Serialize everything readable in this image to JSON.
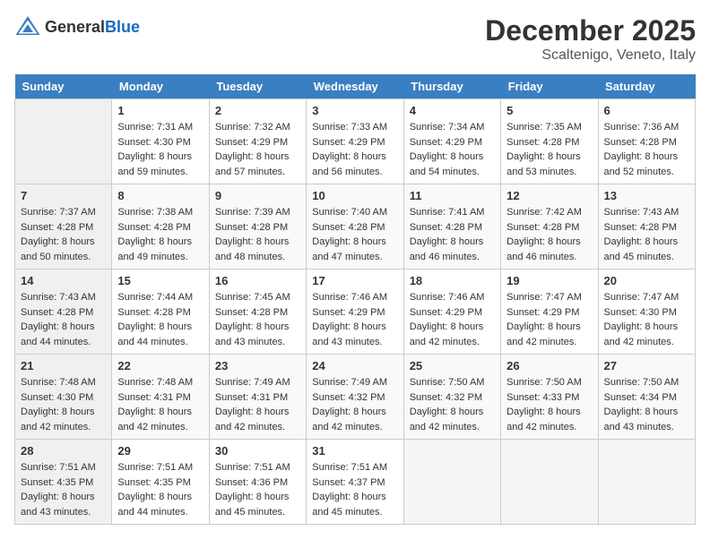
{
  "header": {
    "logo_general": "General",
    "logo_blue": "Blue",
    "month": "December 2025",
    "location": "Scaltenigo, Veneto, Italy"
  },
  "days_of_week": [
    "Sunday",
    "Monday",
    "Tuesday",
    "Wednesday",
    "Thursday",
    "Friday",
    "Saturday"
  ],
  "weeks": [
    [
      {
        "day": "",
        "sunrise": "",
        "sunset": "",
        "daylight": "",
        "empty": true
      },
      {
        "day": "1",
        "sunrise": "Sunrise: 7:31 AM",
        "sunset": "Sunset: 4:30 PM",
        "daylight": "Daylight: 8 hours and 59 minutes."
      },
      {
        "day": "2",
        "sunrise": "Sunrise: 7:32 AM",
        "sunset": "Sunset: 4:29 PM",
        "daylight": "Daylight: 8 hours and 57 minutes."
      },
      {
        "day": "3",
        "sunrise": "Sunrise: 7:33 AM",
        "sunset": "Sunset: 4:29 PM",
        "daylight": "Daylight: 8 hours and 56 minutes."
      },
      {
        "day": "4",
        "sunrise": "Sunrise: 7:34 AM",
        "sunset": "Sunset: 4:29 PM",
        "daylight": "Daylight: 8 hours and 54 minutes."
      },
      {
        "day": "5",
        "sunrise": "Sunrise: 7:35 AM",
        "sunset": "Sunset: 4:28 PM",
        "daylight": "Daylight: 8 hours and 53 minutes."
      },
      {
        "day": "6",
        "sunrise": "Sunrise: 7:36 AM",
        "sunset": "Sunset: 4:28 PM",
        "daylight": "Daylight: 8 hours and 52 minutes."
      }
    ],
    [
      {
        "day": "7",
        "sunrise": "Sunrise: 7:37 AM",
        "sunset": "Sunset: 4:28 PM",
        "daylight": "Daylight: 8 hours and 50 minutes."
      },
      {
        "day": "8",
        "sunrise": "Sunrise: 7:38 AM",
        "sunset": "Sunset: 4:28 PM",
        "daylight": "Daylight: 8 hours and 49 minutes."
      },
      {
        "day": "9",
        "sunrise": "Sunrise: 7:39 AM",
        "sunset": "Sunset: 4:28 PM",
        "daylight": "Daylight: 8 hours and 48 minutes."
      },
      {
        "day": "10",
        "sunrise": "Sunrise: 7:40 AM",
        "sunset": "Sunset: 4:28 PM",
        "daylight": "Daylight: 8 hours and 47 minutes."
      },
      {
        "day": "11",
        "sunrise": "Sunrise: 7:41 AM",
        "sunset": "Sunset: 4:28 PM",
        "daylight": "Daylight: 8 hours and 46 minutes."
      },
      {
        "day": "12",
        "sunrise": "Sunrise: 7:42 AM",
        "sunset": "Sunset: 4:28 PM",
        "daylight": "Daylight: 8 hours and 46 minutes."
      },
      {
        "day": "13",
        "sunrise": "Sunrise: 7:43 AM",
        "sunset": "Sunset: 4:28 PM",
        "daylight": "Daylight: 8 hours and 45 minutes."
      }
    ],
    [
      {
        "day": "14",
        "sunrise": "Sunrise: 7:43 AM",
        "sunset": "Sunset: 4:28 PM",
        "daylight": "Daylight: 8 hours and 44 minutes."
      },
      {
        "day": "15",
        "sunrise": "Sunrise: 7:44 AM",
        "sunset": "Sunset: 4:28 PM",
        "daylight": "Daylight: 8 hours and 44 minutes."
      },
      {
        "day": "16",
        "sunrise": "Sunrise: 7:45 AM",
        "sunset": "Sunset: 4:28 PM",
        "daylight": "Daylight: 8 hours and 43 minutes."
      },
      {
        "day": "17",
        "sunrise": "Sunrise: 7:46 AM",
        "sunset": "Sunset: 4:29 PM",
        "daylight": "Daylight: 8 hours and 43 minutes."
      },
      {
        "day": "18",
        "sunrise": "Sunrise: 7:46 AM",
        "sunset": "Sunset: 4:29 PM",
        "daylight": "Daylight: 8 hours and 42 minutes."
      },
      {
        "day": "19",
        "sunrise": "Sunrise: 7:47 AM",
        "sunset": "Sunset: 4:29 PM",
        "daylight": "Daylight: 8 hours and 42 minutes."
      },
      {
        "day": "20",
        "sunrise": "Sunrise: 7:47 AM",
        "sunset": "Sunset: 4:30 PM",
        "daylight": "Daylight: 8 hours and 42 minutes."
      }
    ],
    [
      {
        "day": "21",
        "sunrise": "Sunrise: 7:48 AM",
        "sunset": "Sunset: 4:30 PM",
        "daylight": "Daylight: 8 hours and 42 minutes."
      },
      {
        "day": "22",
        "sunrise": "Sunrise: 7:48 AM",
        "sunset": "Sunset: 4:31 PM",
        "daylight": "Daylight: 8 hours and 42 minutes."
      },
      {
        "day": "23",
        "sunrise": "Sunrise: 7:49 AM",
        "sunset": "Sunset: 4:31 PM",
        "daylight": "Daylight: 8 hours and 42 minutes."
      },
      {
        "day": "24",
        "sunrise": "Sunrise: 7:49 AM",
        "sunset": "Sunset: 4:32 PM",
        "daylight": "Daylight: 8 hours and 42 minutes."
      },
      {
        "day": "25",
        "sunrise": "Sunrise: 7:50 AM",
        "sunset": "Sunset: 4:32 PM",
        "daylight": "Daylight: 8 hours and 42 minutes."
      },
      {
        "day": "26",
        "sunrise": "Sunrise: 7:50 AM",
        "sunset": "Sunset: 4:33 PM",
        "daylight": "Daylight: 8 hours and 42 minutes."
      },
      {
        "day": "27",
        "sunrise": "Sunrise: 7:50 AM",
        "sunset": "Sunset: 4:34 PM",
        "daylight": "Daylight: 8 hours and 43 minutes."
      }
    ],
    [
      {
        "day": "28",
        "sunrise": "Sunrise: 7:51 AM",
        "sunset": "Sunset: 4:35 PM",
        "daylight": "Daylight: 8 hours and 43 minutes."
      },
      {
        "day": "29",
        "sunrise": "Sunrise: 7:51 AM",
        "sunset": "Sunset: 4:35 PM",
        "daylight": "Daylight: 8 hours and 44 minutes."
      },
      {
        "day": "30",
        "sunrise": "Sunrise: 7:51 AM",
        "sunset": "Sunset: 4:36 PM",
        "daylight": "Daylight: 8 hours and 45 minutes."
      },
      {
        "day": "31",
        "sunrise": "Sunrise: 7:51 AM",
        "sunset": "Sunset: 4:37 PM",
        "daylight": "Daylight: 8 hours and 45 minutes."
      },
      {
        "day": "",
        "sunrise": "",
        "sunset": "",
        "daylight": "",
        "empty": true
      },
      {
        "day": "",
        "sunrise": "",
        "sunset": "",
        "daylight": "",
        "empty": true
      },
      {
        "day": "",
        "sunrise": "",
        "sunset": "",
        "daylight": "",
        "empty": true
      }
    ]
  ]
}
